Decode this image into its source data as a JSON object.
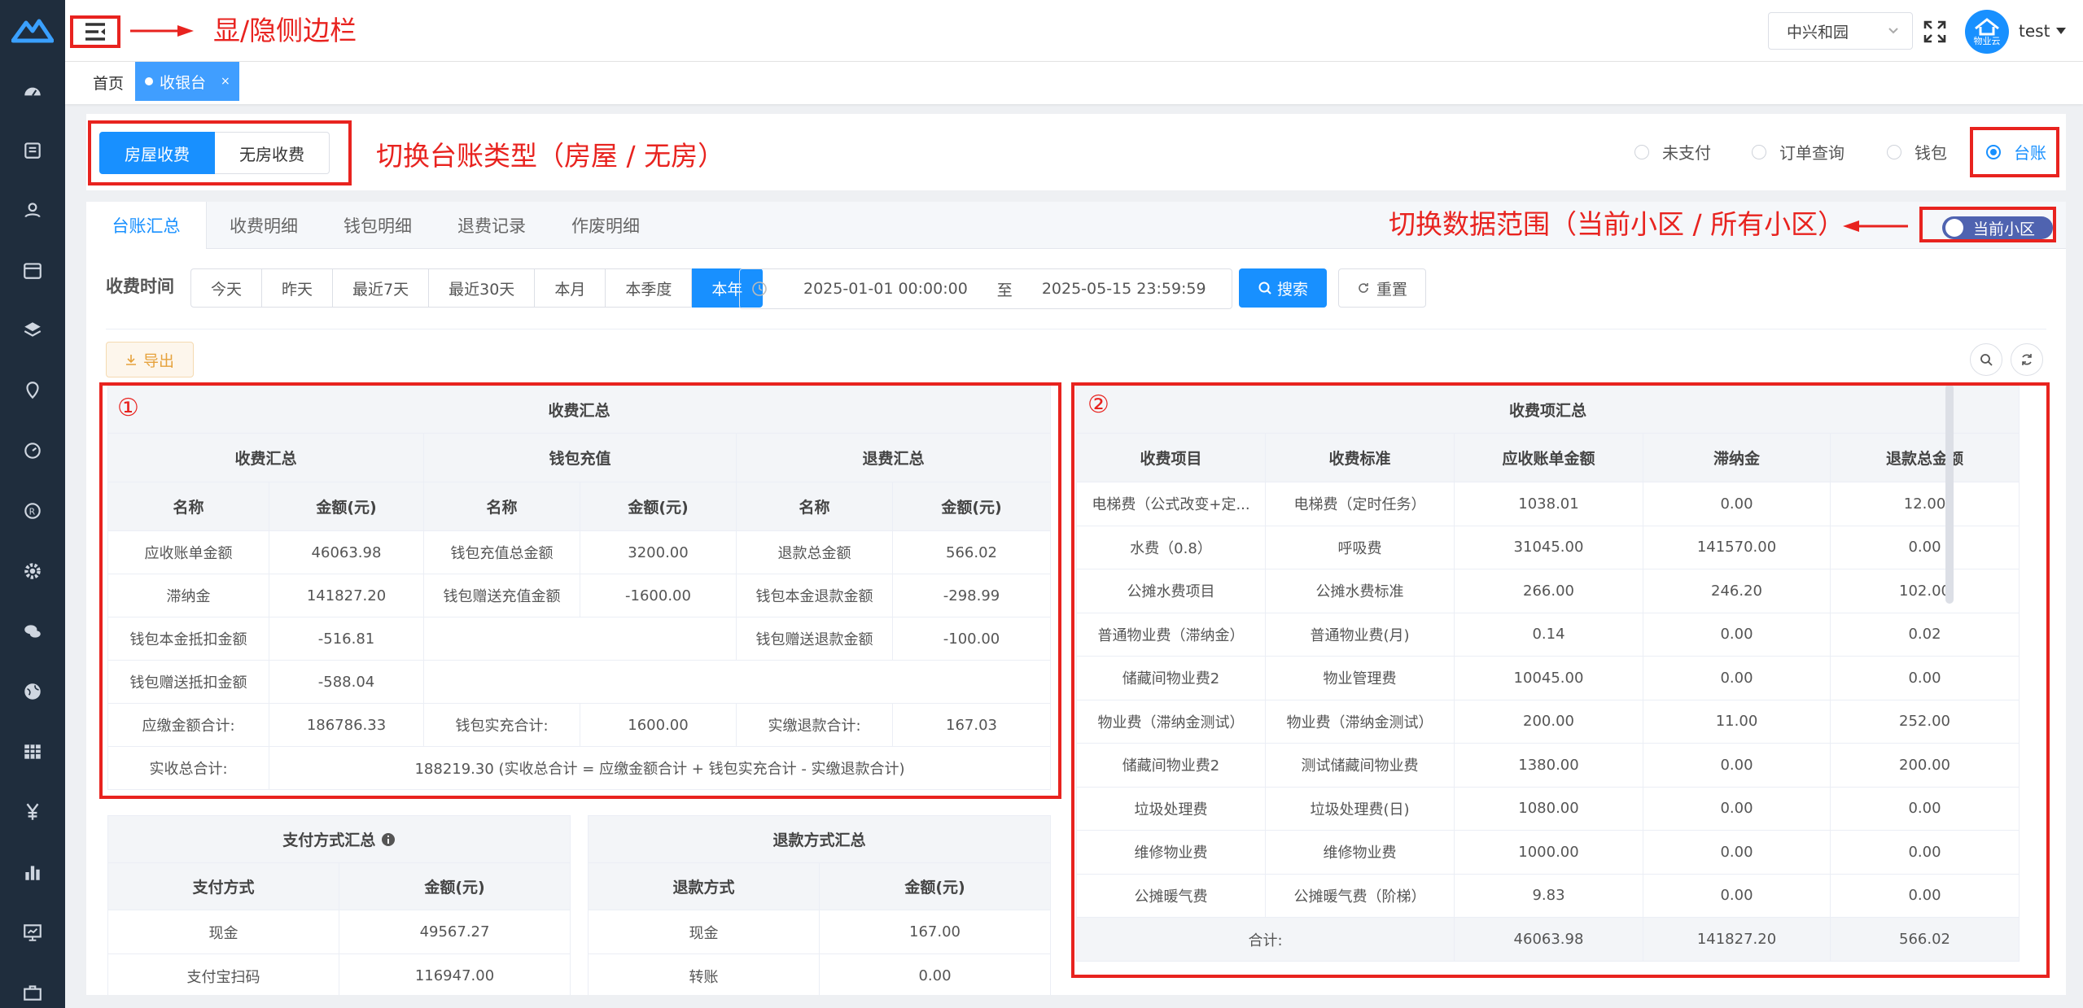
{
  "header": {
    "community": "中兴和园",
    "username": "test",
    "avatar_text": "物业云"
  },
  "annotations": {
    "toggle_sidebar": "显/隐侧边栏",
    "switch_type": "切换台账类型（房屋 / 无房）",
    "switch_scope": "切换数据范围（当前小区 / 所有小区）",
    "mark1": "①",
    "mark2": "②"
  },
  "tags": {
    "home": "首页",
    "active": "收银台",
    "close": "×"
  },
  "type_toggle": {
    "house": "房屋收费",
    "no_house": "无房收费"
  },
  "view_radios": [
    {
      "label": "未支付",
      "selected": false
    },
    {
      "label": "订单查询",
      "selected": false
    },
    {
      "label": "钱包",
      "selected": false
    },
    {
      "label": "台账",
      "selected": true
    }
  ],
  "tabs": [
    "台账汇总",
    "收费明细",
    "钱包明细",
    "退费记录",
    "作废明细"
  ],
  "scope_switch": "当前小区",
  "filter": {
    "label": "收费时间",
    "quick": [
      "今天",
      "昨天",
      "最近7天",
      "最近30天",
      "本月",
      "本季度",
      "本年"
    ],
    "start": "2025-01-01 00:00:00",
    "to": "至",
    "end": "2025-05-15 23:59:59",
    "search": "搜索",
    "reset": "重置",
    "export": "导出"
  },
  "summary": {
    "title": "收费汇总",
    "groups": [
      "收费汇总",
      "钱包充值",
      "退费汇总"
    ],
    "col_name": "名称",
    "col_amount": "金额(元)",
    "rows": [
      [
        "应收账单金额",
        "46063.98",
        "钱包充值总金额",
        "3200.00",
        "退款总金额",
        "566.02"
      ],
      [
        "滞纳金",
        "141827.20",
        "钱包赠送充值金额",
        "-1600.00",
        "钱包本金退款金额",
        "-298.99"
      ],
      [
        "钱包本金抵扣金额",
        "-516.81",
        "",
        "",
        "钱包赠送退款金额",
        "-100.00"
      ],
      [
        "钱包赠送抵扣金额",
        "-588.04",
        "",
        "",
        "",
        ""
      ],
      [
        "应缴金额合计:",
        "186786.33",
        "钱包实充合计:",
        "1600.00",
        "实缴退款合计:",
        "167.03"
      ]
    ],
    "total_label": "实收总合计:",
    "total_value": "188219.30 (实收总合计 = 应缴金额合计 + 钱包实充合计 - 实缴退款合计)"
  },
  "payment": {
    "title": "支付方式汇总",
    "cols": [
      "支付方式",
      "金额(元)"
    ],
    "rows": [
      [
        "现金",
        "49567.27"
      ],
      [
        "支付宝扫码",
        "116947.00"
      ]
    ]
  },
  "refund": {
    "title": "退款方式汇总",
    "cols": [
      "退款方式",
      "金额(元)"
    ],
    "rows": [
      [
        "现金",
        "167.00"
      ],
      [
        "转账",
        "0.00"
      ]
    ]
  },
  "items": {
    "title": "收费项汇总",
    "cols": [
      "收费项目",
      "收费标准",
      "应收账单金额",
      "滞纳金",
      "退款总金额"
    ],
    "rows": [
      [
        "电梯费（公式改变+定...",
        "电梯费（定时任务）",
        "1038.01",
        "0.00",
        "12.00"
      ],
      [
        "水费（0.8）",
        "呼吸费",
        "31045.00",
        "141570.00",
        "0.00"
      ],
      [
        "公摊水费项目",
        "公摊水费标准",
        "266.00",
        "246.20",
        "102.00"
      ],
      [
        "普通物业费（滞纳金）",
        "普通物业费(月)",
        "0.14",
        "0.00",
        "0.02"
      ],
      [
        "储藏间物业费2",
        "物业管理费",
        "10045.00",
        "0.00",
        "0.00"
      ],
      [
        "物业费（滞纳金测试）",
        "物业费（滞纳金测试）",
        "200.00",
        "11.00",
        "252.00"
      ],
      [
        "储藏间物业费2",
        "测试储藏间物业费",
        "1380.00",
        "0.00",
        "200.00"
      ],
      [
        "垃圾处理费",
        "垃圾处理费(日)",
        "1080.00",
        "0.00",
        "0.00"
      ],
      [
        "维修物业费",
        "维修物业费",
        "1000.00",
        "0.00",
        "0.00"
      ],
      [
        "公摊暖气费",
        "公摊暖气费（阶梯）",
        "9.83",
        "0.00",
        "0.00"
      ]
    ],
    "total_label": "合计:",
    "totals": [
      "46063.98",
      "141827.20",
      "566.02"
    ]
  },
  "colors": {
    "primary": "#1890ff",
    "sidebar": "#1f2d3d",
    "annotation": "#e8231f"
  }
}
